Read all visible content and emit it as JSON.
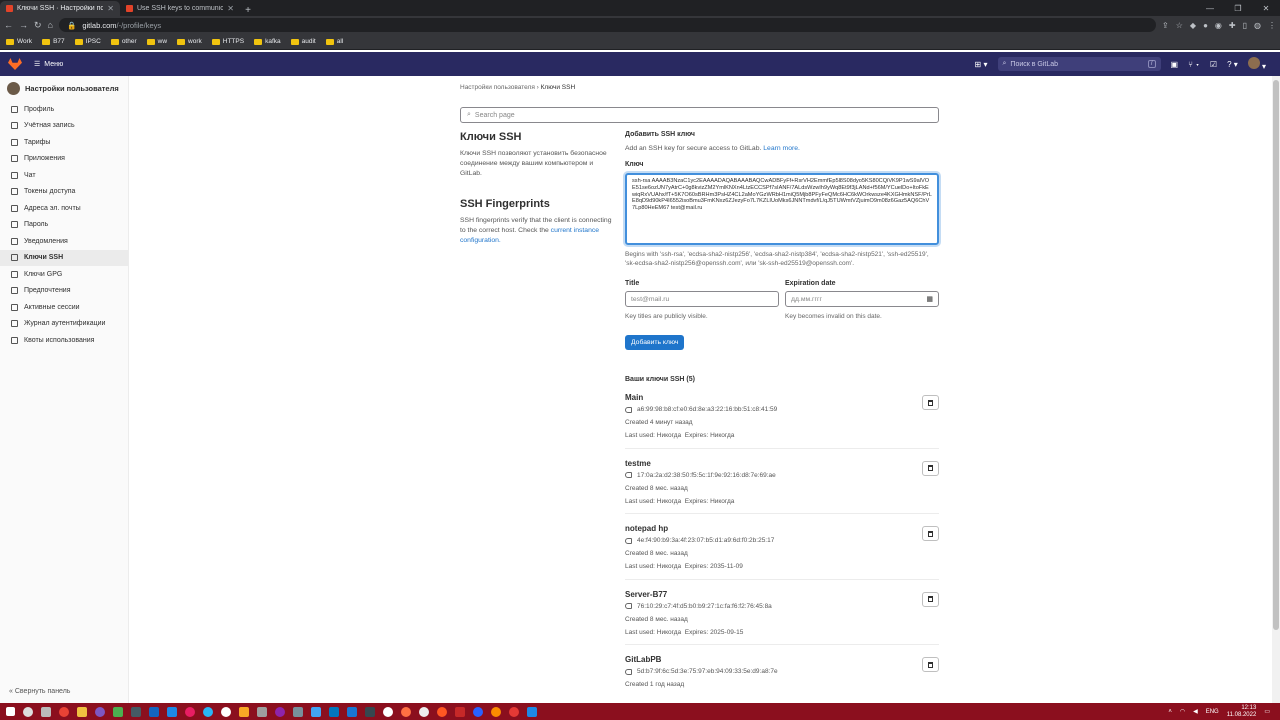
{
  "browser": {
    "tabs": [
      {
        "title": "Ключи SSH · Настройки пользова"
      },
      {
        "title": "Use SSH keys to communicate w"
      }
    ],
    "url_host": "gitlab.com",
    "url_path": "/-/profile/keys",
    "bookmarks": [
      "Work",
      "B77",
      "IPSC",
      "other",
      "ww",
      "work",
      "HTTPS",
      "kafka",
      "audit",
      "all"
    ]
  },
  "gitlab": {
    "menu_label": "Меню",
    "search_placeholder": "Поиск в GitLab",
    "search_kbd": "/"
  },
  "sidebar": {
    "title": "Настройки пользователя",
    "items": [
      {
        "label": "Профиль"
      },
      {
        "label": "Учётная запись"
      },
      {
        "label": "Тарифы"
      },
      {
        "label": "Приложения"
      },
      {
        "label": "Чат"
      },
      {
        "label": "Токены доступа"
      },
      {
        "label": "Адреса эл. почты"
      },
      {
        "label": "Пароль"
      },
      {
        "label": "Уведомления"
      },
      {
        "label": "Ключи SSH"
      },
      {
        "label": "Ключи GPG"
      },
      {
        "label": "Предпочтения"
      },
      {
        "label": "Активные сессии"
      },
      {
        "label": "Журнал аутентификации"
      },
      {
        "label": "Квоты использования"
      }
    ],
    "collapse_label": "Свернуть панель"
  },
  "breadcrumb": {
    "parent": "Настройки пользователя",
    "sep": "›",
    "current": "Ключи SSH"
  },
  "search_page_placeholder": "Search page",
  "intro": {
    "title": "Ключи SSH",
    "desc": "Ключи SSH позволяют установить безопасное соединение между вашим компьютером и GitLab.",
    "fp_title": "SSH Fingerprints",
    "fp_desc": "SSH fingerprints verify that the client is connecting to the correct host. Check the",
    "fp_link": "current instance configuration."
  },
  "form": {
    "heading": "Добавить SSH ключ",
    "sub": "Add an SSH key for secure access to GitLab.",
    "learn_more": "Learn more.",
    "key_label": "Ключ",
    "key_value": "ssh-rsa AAAAB3NzaC1yc2EAAAADAQABAAABAQCwADBFyFf+RsrVH2EmmfEp5l8S08dyo5KS80CQiVK9P1wS9alVOE51se6ozUN7yAtrC+0g8kvizZM2YmlKNXn4LtzECCSPf7sIANF/7ALdsWzwIh9yWq8Et9f3jLANd+f56M/YCuelDo+ItoFkEwiqRxVUAhx/fT+5K7O60sBRHm3PsHZ4CL2aMoYGzWRbH1miQ5Mjb8PFyFeQMc6HC6kWOrkwsze4KXGHmkNSF/PrLE8qD9d90kP4I6552isoBmu3FmKNxz6ZJezyFo7L7KZLIUoMks6JNNTmdvf/L/qJ5TUWmtVZjuimO9m08z6Gaz5AQ6ChV7Lp80HeEM67 test@mail.ru",
    "key_help": "Begins with 'ssh-rsa', 'ecdsa-sha2-nistp256', 'ecdsa-sha2-nistp384', 'ecdsa-sha2-nistp521', 'ssh-ed25519', 'sk-ecdsa-sha2-nistp256@openssh.com', или 'sk-ssh-ed25519@openssh.com'.",
    "title_label": "Title",
    "title_value": "test@mail.ru",
    "title_help": "Key titles are publicly visible.",
    "exp_label": "Expiration date",
    "exp_placeholder": "дд.мм.гггг",
    "exp_help": "Key becomes invalid on this date.",
    "submit": "Добавить ключ"
  },
  "keys_heading": "Ваши ключи SSH (5)",
  "keys": [
    {
      "title": "Main",
      "fingerprint": "a6:99:98:b8:cf:e0:6d:8e:a3:22:16:bb:51:c8:41:59",
      "created": "Created 4 минут назад",
      "used": "Last used: Никогда",
      "expires": "Expires: Никогда"
    },
    {
      "title": "testme",
      "fingerprint": "17:0a:2a:d2:38:50:f5:5c:1f:9e:92:16:d8:7e:69:ae",
      "created": "Created 8 мес. назад",
      "used": "Last used: Никогда",
      "expires": "Expires: Никогда"
    },
    {
      "title": "notepad hp",
      "fingerprint": "4e:f4:90:b9:3a:4f:23:07:b5:d1:a9:6d:f0:2b:25:17",
      "created": "Created 8 мес. назад",
      "used": "Last used: Никогда",
      "expires": "Expires: 2035-11-09"
    },
    {
      "title": "Server-B77",
      "fingerprint": "76:10:29:c7:4f:d5:b0:b9:27:1c:fa:f6:f2:76:45:8a",
      "created": "Created 8 мес. назад",
      "used": "Last used: Никогда",
      "expires": "Expires: 2025-09-15"
    },
    {
      "title": "GitLabPB",
      "fingerprint": "5d:b7:9f:6c:5d:3e:75:97:eb:94:09:33:5e:d9:a8:7e",
      "created": "Created 1 год назад",
      "used": "",
      "expires": ""
    }
  ],
  "tray": {
    "lang": "ENG",
    "time": "12:13",
    "date": "11.08.2022"
  }
}
